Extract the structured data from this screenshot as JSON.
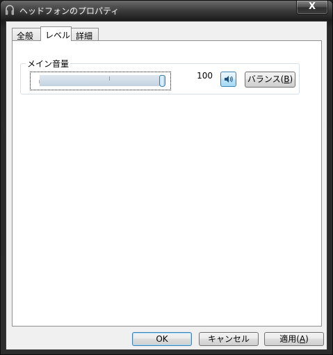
{
  "window": {
    "title": "ヘッドフォンのプロパティ",
    "close_label": "X"
  },
  "tabs": [
    {
      "label": "全般",
      "active": false
    },
    {
      "label": "レベル",
      "active": true
    },
    {
      "label": "詳細",
      "active": false
    }
  ],
  "levels": {
    "group_label": "メイン音量",
    "volume_value": "100",
    "volume_fraction": 1.0,
    "mute_icon": "speaker-icon",
    "balance_label_prefix": "バランス(",
    "balance_mnemonic": "B",
    "balance_label_suffix": ")"
  },
  "buttons": {
    "ok": "OK",
    "cancel": "キャンセル",
    "apply_prefix": "適用(",
    "apply_mnemonic": "A",
    "apply_suffix": ")"
  },
  "colors": {
    "title_text": "#f2f2f2",
    "client_bg": "#f0f0f0",
    "accent": "#3c7fb1"
  }
}
